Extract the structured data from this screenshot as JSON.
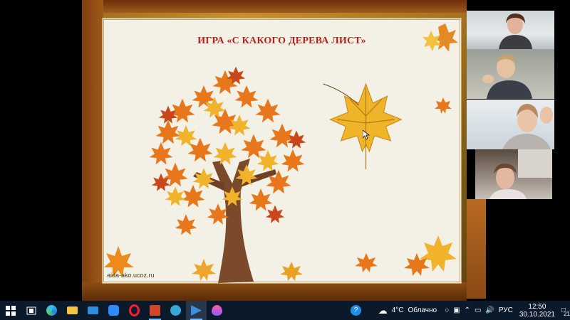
{
  "window": {
    "controls": [
      "minimize-icon",
      "restore-icon",
      "close-icon"
    ]
  },
  "slide": {
    "title": "ИГРА «С КАКОГО ДЕРЕВА ЛИСТ»",
    "watermark": "aida-ako.ucoz.ru",
    "colors": {
      "title": "#b0241d",
      "panel": "#f3f1e6",
      "leaf_orange": "#e8771c",
      "leaf_yellow": "#f2b32c",
      "trunk": "#7b4a2b"
    }
  },
  "taskbar": {
    "icons": [
      "windows-start-icon",
      "task-view-icon",
      "edge-icon",
      "file-explorer-icon",
      "mail-icon",
      "zoom-icon",
      "opera-icon",
      "powerpoint-icon",
      "network-app-icon",
      "media-player-icon",
      "droplet-app-icon",
      "help-icon"
    ],
    "weather": {
      "temp": "4°C",
      "condition": "Облачно"
    },
    "language": "РУС",
    "time": "12:50",
    "date": "30.10.2021",
    "notifications": "21"
  }
}
